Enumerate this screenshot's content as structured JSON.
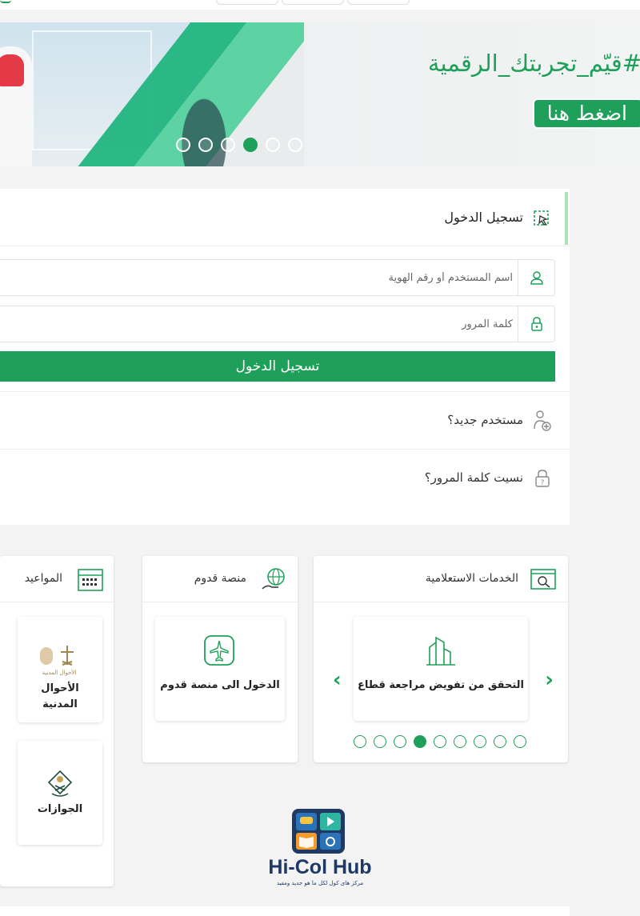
{
  "banner": {
    "headline": "#قيّم_تجربتك_الرقمية",
    "cta_label": "اضغط هنا",
    "slide_count": 6,
    "active_slide_index": 3
  },
  "login": {
    "title": "تسجيل الدخول",
    "username_placeholder": "اسم المستخدم أو رقم الهوية",
    "password_placeholder": "كلمة المرور",
    "submit_label": "تسجيل الدخول",
    "new_user_label": "مستخدم جديد؟",
    "forgot_password_label": "نسيت كلمة المرور؟"
  },
  "inquiry_services": {
    "title": "الخدمات الاستعلامية",
    "tile_label": "التحقق من تفويض مراجعة قطاع",
    "page_count": 9,
    "active_page_index": 3
  },
  "qudoom": {
    "title": "منصة قدوم",
    "tile_label": "الدخول الى منصة قدوم"
  },
  "appointments": {
    "title": "المواعيد",
    "tiles": [
      {
        "label": "الأحوال المدنية",
        "logo_text": "الأحوال المدنية"
      },
      {
        "label": "الجوازات"
      }
    ]
  },
  "watermark": {
    "name": "Hi-Col Hub",
    "tagline": "مرکز های کول لکل ما هو جديد ومفيد"
  },
  "colors": {
    "brand_green": "#1fa05a",
    "accent_light_green": "#a6e6b5",
    "logo_blue": "#1e3a64"
  }
}
